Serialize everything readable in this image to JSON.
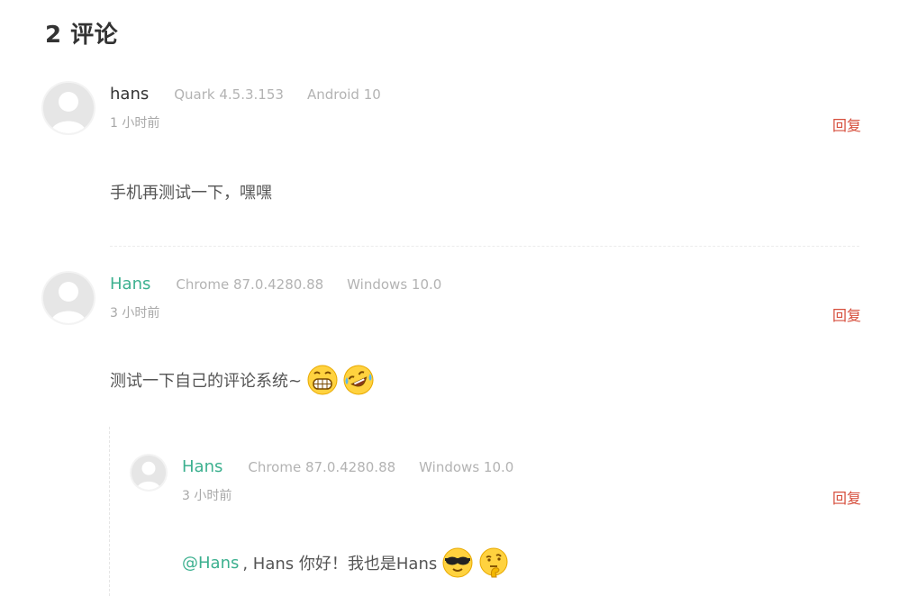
{
  "heading": "2 评论",
  "comments": [
    {
      "author": "hans",
      "browser": "Quark 4.5.3.153",
      "os": "Android 10",
      "time": "1 小时前",
      "reply_label": "回复",
      "text": "手机再测试一下，嘿嘿"
    },
    {
      "author": "Hans",
      "browser": "Chrome 87.0.4280.88",
      "os": "Windows 10.0",
      "time": "3 小时前",
      "reply_label": "回复",
      "text": "测试一下自己的评论系统~",
      "emojis": [
        "grin-emoji",
        "laugh-crying-emoji"
      ]
    },
    {
      "author": "Hans",
      "browser": "Chrome 87.0.4280.88",
      "os": "Windows 10.0",
      "time": "3 小时前",
      "reply_label": "回复",
      "mention": "@Hans",
      "text": ", Hans 你好！我也是Hans",
      "emojis": [
        "sunglasses-emoji",
        "thinking-emoji"
      ]
    }
  ],
  "colors": {
    "link_green": "#3cb08f",
    "reply_red": "#d64e3c",
    "meta_gray": "#b3b3b3"
  }
}
